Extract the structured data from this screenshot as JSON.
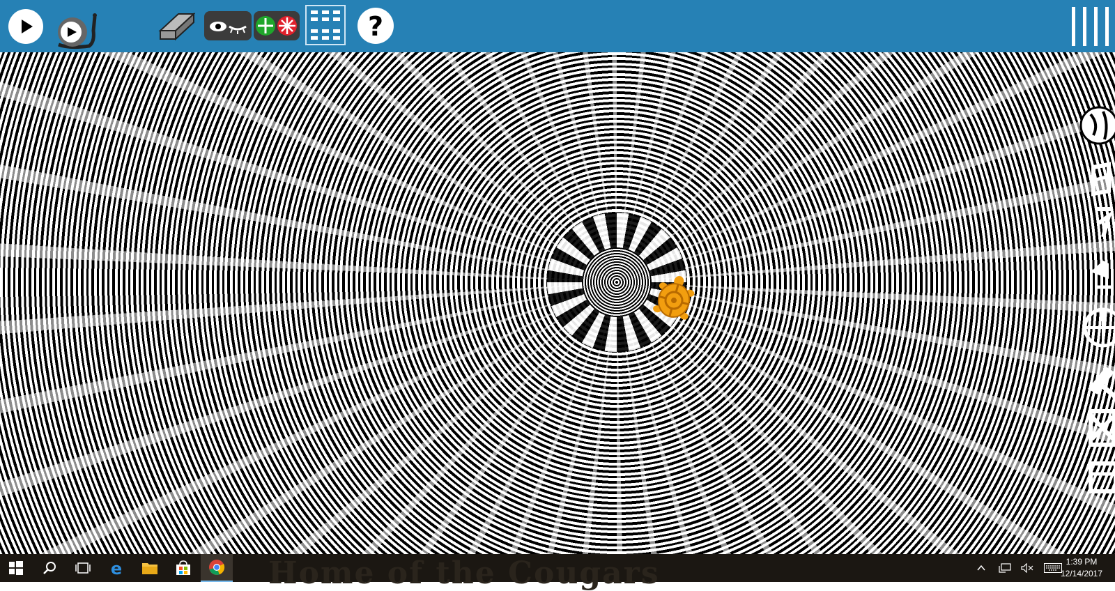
{
  "toolbar": {
    "background": "#2681b5",
    "buttons": [
      {
        "name": "run-button",
        "icon": "play-icon"
      },
      {
        "name": "run-slow-button",
        "icon": "snail-icon"
      },
      {
        "name": "clear-button",
        "icon": "eraser-icon"
      },
      {
        "name": "hide-blocks-button",
        "icon": "eye-icon"
      },
      {
        "name": "collapse-expand-button",
        "icon": "expand-collapse-icon"
      },
      {
        "name": "grid-button",
        "icon": "grid-icon"
      },
      {
        "name": "help-button",
        "icon": "question-icon"
      }
    ],
    "menu_icon": "hamburger-icon"
  },
  "canvas": {
    "turtle_color": "#f29e0f",
    "pattern": "concentric black and white spiral"
  },
  "palette": {
    "icons": [
      "globe-icon",
      "pen-icon",
      "number-icon",
      "flow-icon",
      "sensor-icon",
      "media-icon",
      "extras-icon",
      "box-icon"
    ]
  },
  "taskbar": {
    "background_text": "Home of the Cougars",
    "icons": [
      "windows-start-icon",
      "search-icon",
      "task-view-icon",
      "edge-icon",
      "file-explorer-icon",
      "store-icon",
      "chrome-icon"
    ],
    "active": "chrome-icon",
    "tray": {
      "time": "1:39 PM",
      "date": "12/14/2017"
    }
  }
}
